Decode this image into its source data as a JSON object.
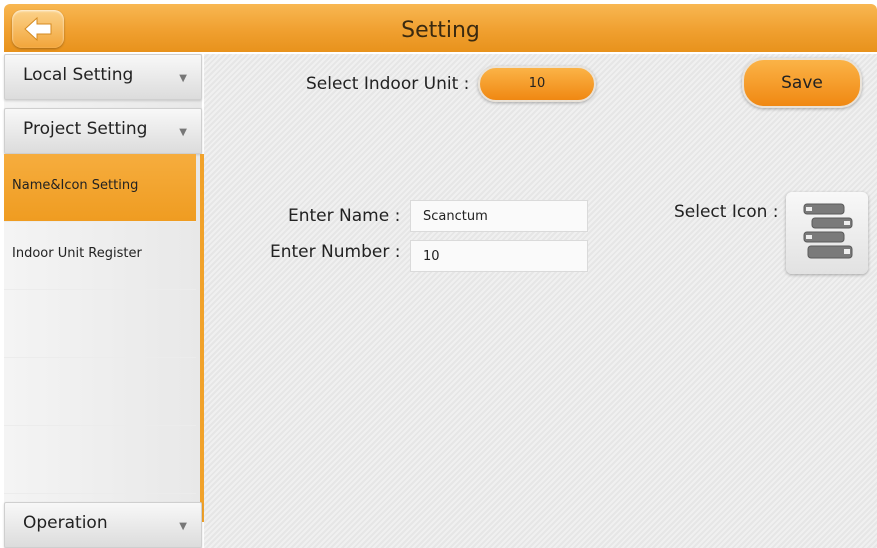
{
  "header": {
    "title": "Setting",
    "back_icon": "arrow-left-icon"
  },
  "sidebar": {
    "local_setting": "Local Setting",
    "project_setting": "Project Setting",
    "items": [
      {
        "label": "Name&Icon Setting",
        "active": true
      },
      {
        "label": "Indoor Unit Register",
        "active": false
      }
    ],
    "operation": "Operation"
  },
  "main": {
    "select_unit_label": "Select Indoor Unit :",
    "select_unit_value": "10",
    "save_label": "Save",
    "name_label": "Enter Name :",
    "name_value": "Scanctum",
    "number_label": "Enter Number :",
    "number_value": "10",
    "select_icon_label": "Select Icon :",
    "selected_icon": "books-icon"
  },
  "colors": {
    "accent": "#f0a030",
    "active_item": "#ef9c21"
  }
}
